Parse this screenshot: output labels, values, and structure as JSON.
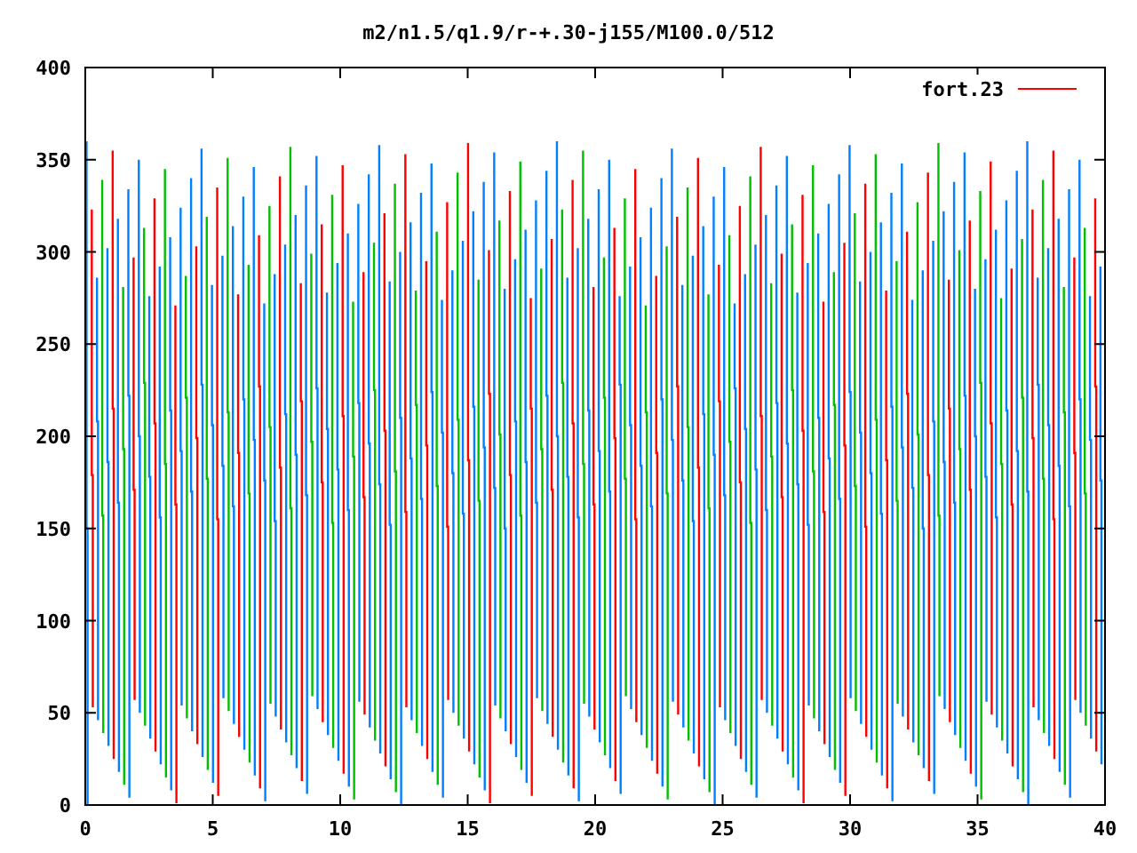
{
  "title": "m2/n1.5/q1.9/r-+.30-j155/M100.0/512",
  "legend": {
    "label": "fort.23"
  },
  "y_axis": {
    "ticks": [
      "400",
      "350",
      "300",
      "250",
      "200",
      "150",
      "100",
      "50",
      "0"
    ]
  },
  "x_axis": {
    "ticks": [
      "0",
      "5",
      "10",
      "15",
      "20",
      "25",
      "30",
      "35",
      "40"
    ]
  }
}
